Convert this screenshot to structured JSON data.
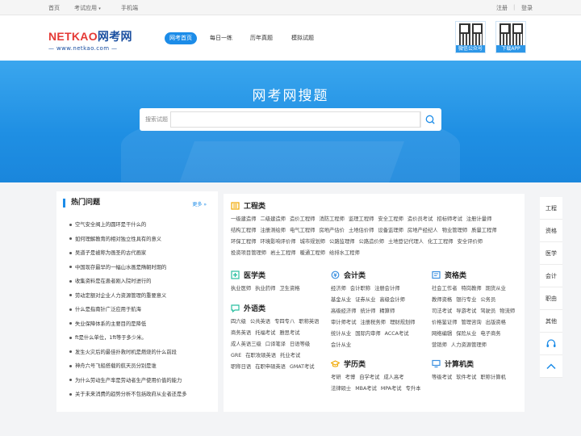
{
  "topbar": {
    "home": "首页",
    "exam_app": "考试应用",
    "mobile": "手机端",
    "register": "注册",
    "divider": "|",
    "login": "登录"
  },
  "logo": {
    "brand_a": "NETKAO",
    "brand_b": "网考网",
    "url": "— www.netkao.com —"
  },
  "nav": [
    "网考首页",
    "每日一练",
    "历年真题",
    "模拟试题"
  ],
  "qr": {
    "wechat": "微信公众号",
    "app": "下载APP"
  },
  "banner": {
    "title": "网考网搜题",
    "search_label": "搜索试题",
    "search_placeholder": ""
  },
  "hot": {
    "title": "热门问题",
    "more": "更多 »",
    "items": [
      "空气安全阀上的圆环是干什么的",
      "如何理解教育的相对独立性具有的意义",
      "吴道子是被称为画圣的古代画家",
      "中国现存最早的一幅山水画是隋朝时期的",
      "收集资料是在患者刚入院时进行的",
      "劳动定额对企业人力资源管理的重要意义",
      "什么是指南针广泛应用于航海",
      "失业保障体系的主要目的是降低",
      "ft是什么单位，1ft等于多少米。",
      "发生火灾后的最佳扑救时机是燃烧的什么前段",
      "神舟六号飞船搭载的航天员分别是谁",
      "为什么劳动生产率是劳动者生产使用价值的能力",
      "关于未来消费的趋势分析不包括政府从业者还是多"
    ]
  },
  "categories": {
    "engineering": {
      "title": "工程类",
      "links": [
        "一级建造师",
        "二级建造师",
        "造价工程师",
        "消防工程师",
        "监理工程师",
        "安全工程师",
        "造价员考试",
        "招标师考试",
        "注册计量师",
        "结构工程师",
        "注册测绘师",
        "电气工程师",
        "房地产估价",
        "土地估价师",
        "设备监理师",
        "房地产经纪人",
        "物业管理师",
        "质量工程师",
        "环保工程师",
        "环境影响评价师",
        "城市规划师",
        "公路监理师",
        "公路造价师",
        "土地登记代理人",
        "化工工程师",
        "安全评价师",
        "投资项目管理师",
        "岩土工程师",
        "暖通工程师",
        "给排水工程师"
      ]
    },
    "medical": {
      "title": "医学类",
      "links": [
        "执业医师",
        "执业药师",
        "卫生资格"
      ]
    },
    "accounting": {
      "title": "会计类",
      "links": [
        "经济师",
        "会计职称",
        "注册会计师",
        "基金从业",
        "证券从业",
        "高级会计师",
        "高级经济师",
        "统计师",
        "精算师",
        "审计师考试",
        "注册税务师",
        "理财规划师",
        "统计从业",
        "国际内审师",
        "ACCA考试",
        "会计从业"
      ]
    },
    "qualification": {
      "title": "资格类",
      "links": [
        "社会工作者",
        "特岗教师",
        "期货从业",
        "教师资格",
        "银行专业",
        "公务员",
        "司法考试",
        "导游考试",
        "驾驶员",
        "物流师",
        "价格鉴证师",
        "管理咨询",
        "出版资格",
        "网络编辑",
        "保险从业",
        "电子商务",
        "营销师",
        "人力资源管理师"
      ]
    },
    "foreign": {
      "title": "外语类",
      "links": [
        "四六级",
        "公共英语",
        "专四专八",
        "职称英语",
        "商务英语",
        "托福考试",
        "雅思考试",
        "成人英语三级",
        "口译笔译",
        "日语等级",
        "GRE",
        "在职攻硕英语",
        "托业考试",
        "职称日语",
        "在职申硕英语",
        "GMAT考试"
      ]
    },
    "education": {
      "title": "学历类",
      "links": [
        "考研",
        "考博",
        "自学考试",
        "成人高考",
        "法律硕士",
        "MBA考试",
        "MPA考试",
        "专升本"
      ]
    },
    "computer": {
      "title": "计算机类",
      "links": [
        "等级考试",
        "软件考试",
        "职称计算机"
      ]
    }
  },
  "sidebar": [
    "工程",
    "资格",
    "医学",
    "会计",
    "职由",
    "其他"
  ],
  "colors": {
    "accent": "#1c8ce8",
    "brand": "#1b4fa0",
    "brand_red": "#e53935"
  }
}
